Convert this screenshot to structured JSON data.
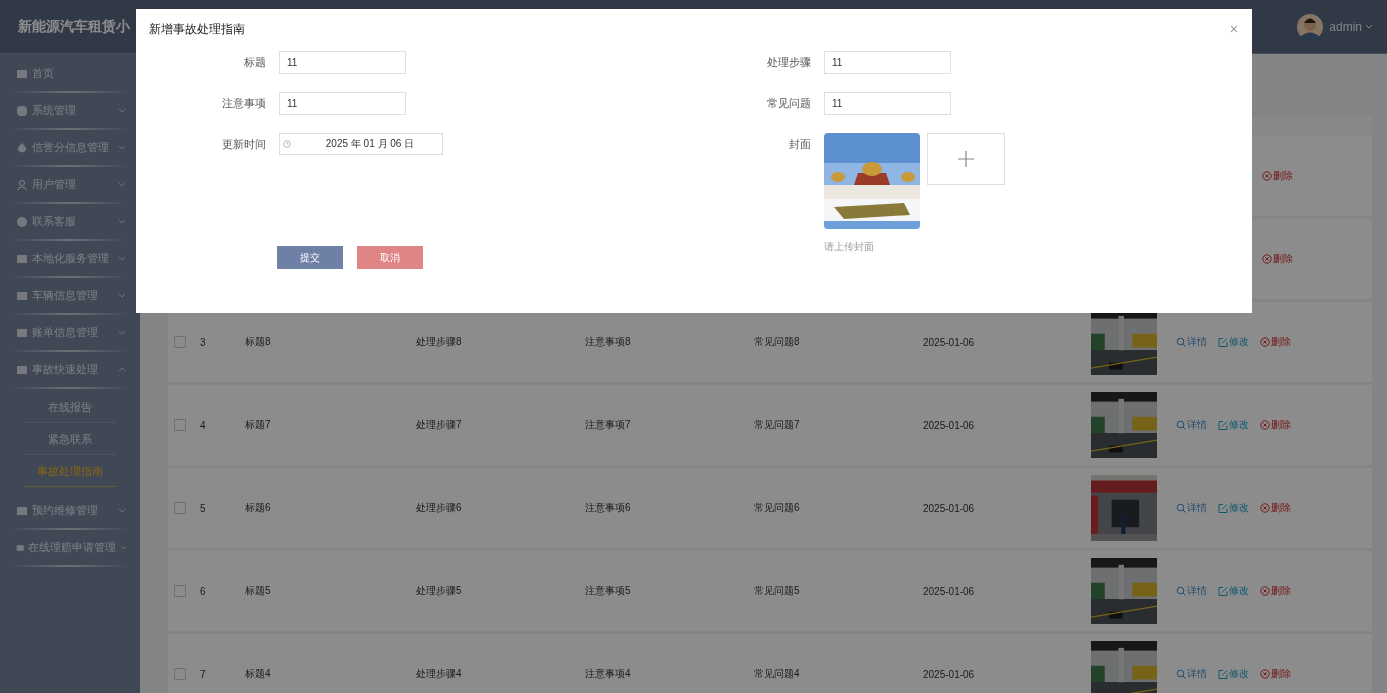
{
  "app": {
    "title": "新能源汽车租赁小"
  },
  "user": {
    "name": "admin"
  },
  "sidebar": {
    "items": [
      {
        "kind": "link",
        "label": "首页"
      },
      {
        "kind": "group",
        "label": "系统管理",
        "expanded": false
      },
      {
        "kind": "group",
        "label": "信誉分信息管理",
        "expanded": false
      },
      {
        "kind": "group",
        "label": "用户管理",
        "expanded": false
      },
      {
        "kind": "group",
        "label": "联系客服",
        "expanded": false
      },
      {
        "kind": "group",
        "label": "本地化服务管理",
        "expanded": false
      },
      {
        "kind": "group",
        "label": "车辆信息管理",
        "expanded": false
      },
      {
        "kind": "group",
        "label": "账单信息管理",
        "expanded": false
      },
      {
        "kind": "group",
        "label": "事故快速处理",
        "expanded": true,
        "children": [
          {
            "label": "在线报告",
            "selected": false
          },
          {
            "label": "紧急联系",
            "selected": false
          },
          {
            "label": "事故处理指南",
            "selected": true
          }
        ]
      },
      {
        "kind": "group",
        "label": "预约维修管理",
        "expanded": false
      },
      {
        "kind": "group",
        "label": "在线理赔申请管理",
        "expanded": false
      }
    ]
  },
  "table": {
    "rows": [
      {
        "actions": [
          {
            "kind": "delete",
            "label": "删除"
          }
        ]
      },
      {
        "actions": [
          {
            "kind": "delete",
            "label": "删除"
          }
        ]
      },
      {
        "checked": false,
        "index": "3",
        "title": "标题8",
        "steps": "处理步骤8",
        "notes": "注意事项8",
        "faq": "常见问题8",
        "date": "2025-01-06",
        "actions": [
          {
            "kind": "view",
            "label": "详情"
          },
          {
            "kind": "edit",
            "label": "修改"
          },
          {
            "kind": "delete",
            "label": "删除"
          }
        ]
      },
      {
        "checked": false,
        "index": "4",
        "title": "标题7",
        "steps": "处理步骤7",
        "notes": "注意事项7",
        "faq": "常见问题7",
        "date": "2025-01-06",
        "actions": [
          {
            "kind": "view",
            "label": "详情"
          },
          {
            "kind": "edit",
            "label": "修改"
          },
          {
            "kind": "delete",
            "label": "删除"
          }
        ]
      },
      {
        "checked": false,
        "index": "5",
        "title": "标题6",
        "steps": "处理步骤6",
        "notes": "注意事项6",
        "faq": "常见问题6",
        "date": "2025-01-06",
        "actions": [
          {
            "kind": "view",
            "label": "详情"
          },
          {
            "kind": "edit",
            "label": "修改"
          },
          {
            "kind": "delete",
            "label": "删除"
          }
        ]
      },
      {
        "checked": false,
        "index": "6",
        "title": "标题5",
        "steps": "处理步骤5",
        "notes": "注意事项5",
        "faq": "常见问题5",
        "date": "2025-01-06",
        "actions": [
          {
            "kind": "view",
            "label": "详情"
          },
          {
            "kind": "edit",
            "label": "修改"
          },
          {
            "kind": "delete",
            "label": "删除"
          }
        ]
      },
      {
        "checked": false,
        "index": "7",
        "title": "标题4",
        "steps": "处理步骤4",
        "notes": "注意事项4",
        "faq": "常见问题4",
        "date": "2025-01-06",
        "actions": [
          {
            "kind": "view",
            "label": "详情"
          },
          {
            "kind": "edit",
            "label": "修改"
          },
          {
            "kind": "delete",
            "label": "删除"
          }
        ]
      }
    ]
  },
  "dialog": {
    "title": "新增事故处理指南",
    "close": "×",
    "columns": [
      [
        {
          "kind": "text",
          "label": "标题",
          "value": "11"
        },
        {
          "kind": "text",
          "label": "注意事项",
          "value": "11"
        },
        {
          "kind": "date",
          "label": "更新时间",
          "value": "2025 年 01 月 06 日"
        }
      ],
      [
        {
          "kind": "text",
          "label": "处理步骤",
          "value": "11"
        },
        {
          "kind": "text",
          "label": "常见问题",
          "value": "11"
        },
        {
          "label": "封面",
          "hint": "请上传封面"
        }
      ]
    ],
    "buttons": [
      {
        "kind": "primary",
        "label": "提交"
      },
      {
        "kind": "danger",
        "label": "取消"
      }
    ]
  }
}
